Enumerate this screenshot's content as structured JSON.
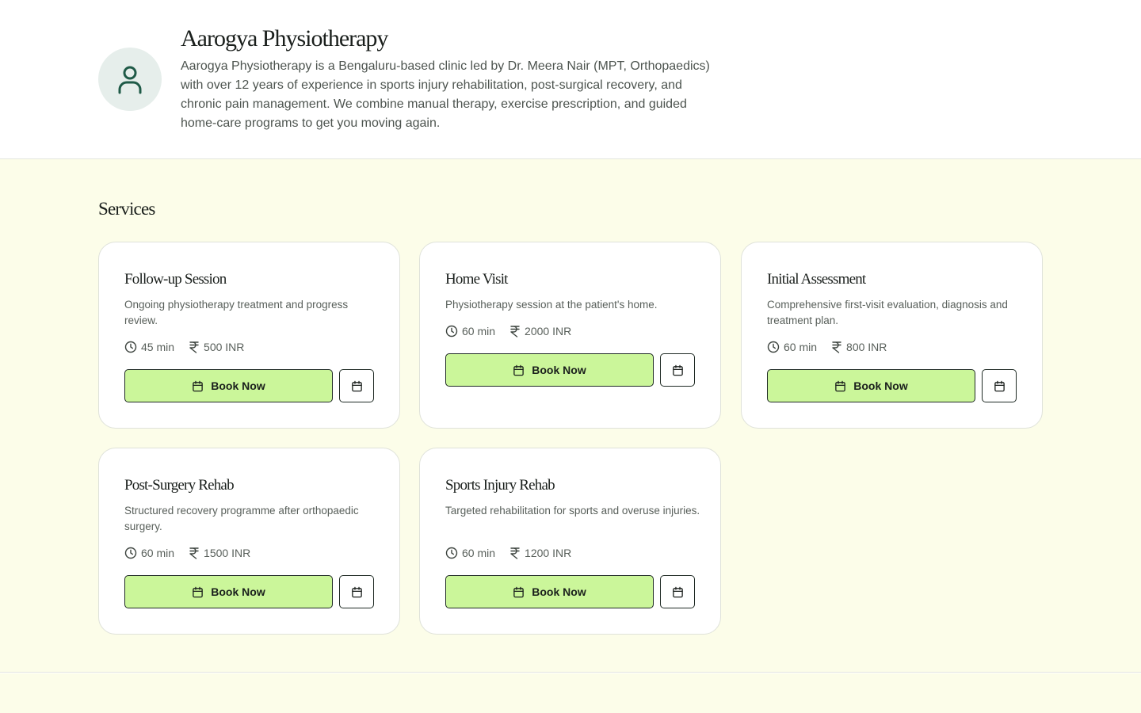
{
  "clinic": {
    "name": "Aarogya Physiotherapy",
    "description": "Aarogya Physiotherapy is a Bengaluru-based clinic led by Dr. Meera Nair (MPT, Orthopaedics) with over 12 years of experience in sports injury rehabilitation, post-surgical recovery, and chronic pain management. We combine manual therapy, exercise prescription, and guided home-care programs to get you moving again.",
    "avatar_icon": "user-icon"
  },
  "services": {
    "title": "Services",
    "book_label": "Book Now",
    "items": [
      {
        "title": "Follow-up Session",
        "description": "Ongoing physiotherapy treatment and progress review.",
        "duration": "45 min",
        "price": "500 INR"
      },
      {
        "title": "Home Visit",
        "description": "Physiotherapy session at the patient's home.",
        "duration": "60 min",
        "price": "2000 INR"
      },
      {
        "title": "Initial Assessment",
        "description": "Comprehensive first-visit evaluation, diagnosis and treatment plan.",
        "duration": "60 min",
        "price": "800 INR"
      },
      {
        "title": "Post-Surgery Rehab",
        "description": "Structured recovery programme after orthopaedic surgery.",
        "duration": "60 min",
        "price": "1500 INR"
      },
      {
        "title": "Sports Injury Rehab",
        "description": "Targeted rehabilitation for sports and overuse injuries.",
        "duration": "60 min",
        "price": "1200 INR"
      }
    ]
  },
  "colors": {
    "accent": "#cbf69a",
    "section_bg": "#fcfde9",
    "avatar_bg": "#e6eeeb",
    "avatar_icon": "#1f5a47"
  }
}
